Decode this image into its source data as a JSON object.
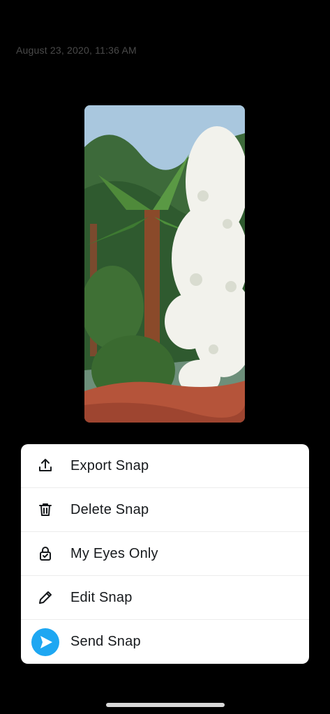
{
  "timestamp": "August 23, 2020, 11:36 AM",
  "photo": {
    "description_icon": "snap-photo"
  },
  "menu": {
    "items": [
      {
        "label": "Export Snap",
        "icon": "export-icon"
      },
      {
        "label": "Delete Snap",
        "icon": "trash-icon"
      },
      {
        "label": "My Eyes Only",
        "icon": "lock-icon"
      },
      {
        "label": "Edit Snap",
        "icon": "pencil-icon"
      },
      {
        "label": "Send Snap",
        "icon": "send-icon"
      }
    ]
  },
  "colors": {
    "accent": "#1ea7f2",
    "background": "#000000",
    "sheet": "#ffffff"
  }
}
